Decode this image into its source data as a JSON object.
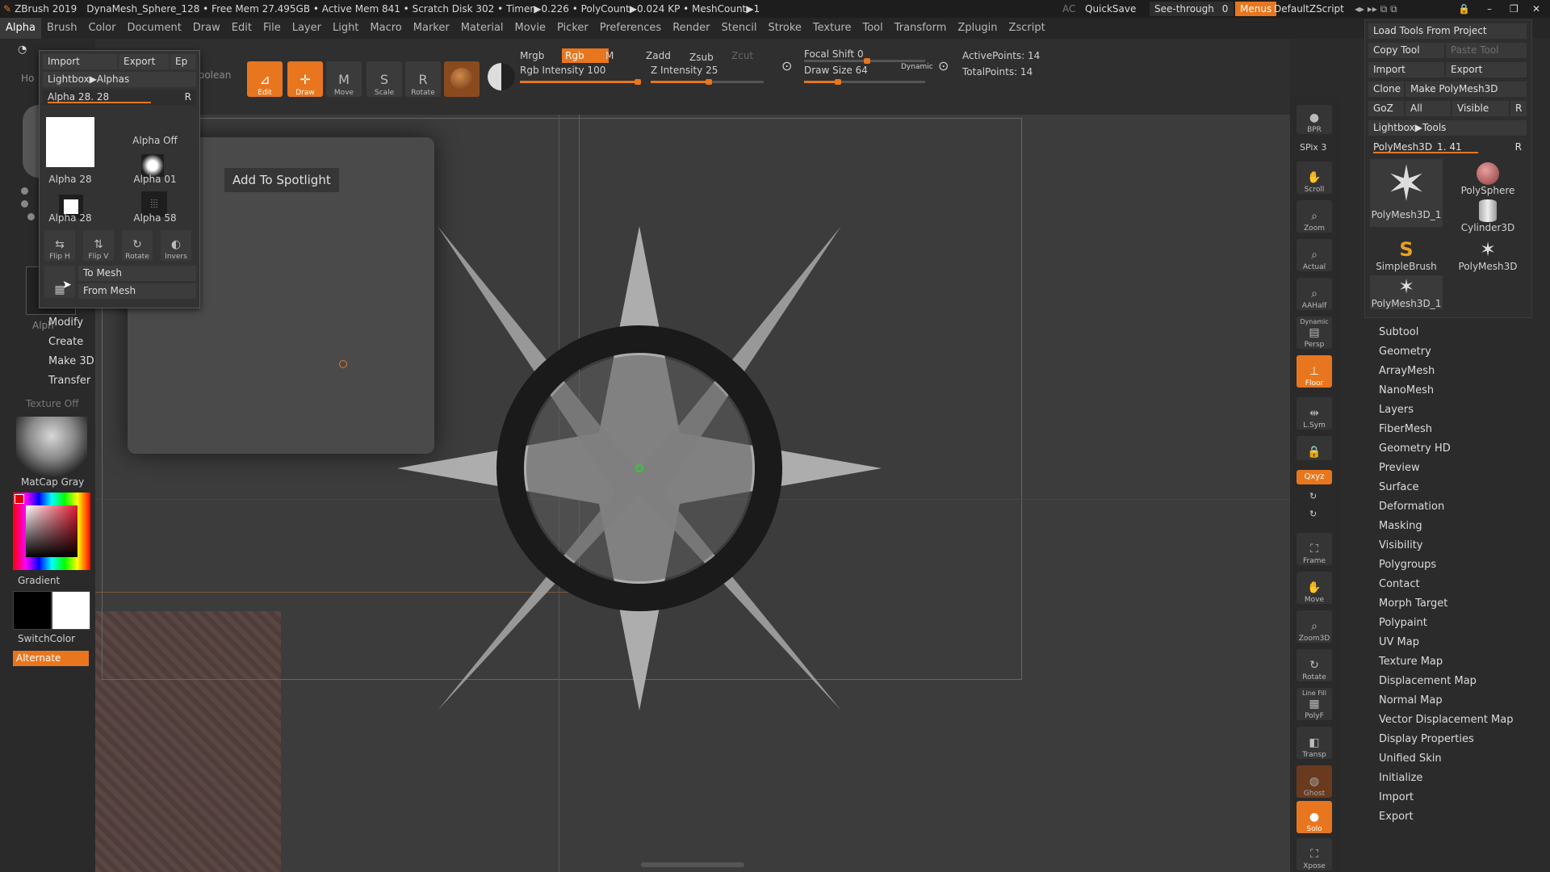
{
  "titlebar": {
    "app": "ZBrush 2019",
    "info": "DynaMesh_Sphere_128   • Free Mem 27.495GB • Active Mem 841 • Scratch Disk 302 • Timer▶0.226 • PolyCount▶0.024 KP • MeshCount▶1",
    "ac": "AC",
    "quicksave": "QuickSave",
    "seethrough": "See-through",
    "seethrough_value": "0",
    "menus": "Menus",
    "script": "DefaultZScript"
  },
  "menubar": {
    "items": [
      "Alpha",
      "Brush",
      "Color",
      "Document",
      "Draw",
      "Edit",
      "File",
      "Layer",
      "Light",
      "Macro",
      "Marker",
      "Material",
      "Movie",
      "Picker",
      "Preferences",
      "Render",
      "Stencil",
      "Stroke",
      "Texture",
      "Tool",
      "Transform",
      "Zplugin",
      "Zscript"
    ]
  },
  "shelf": {
    "edit": "Edit",
    "draw": "Draw",
    "move": "Move",
    "scale": "Scale",
    "rotate": "Rotate",
    "mrgb": "Mrgb",
    "rgb": "Rgb",
    "m": "M",
    "rgb_intensity": "Rgb Intensity 100",
    "rgb_intensity_value": 100,
    "zadd": "Zadd",
    "zsub": "Zsub",
    "zcut": "Zcut",
    "z_intensity": "Z Intensity 25",
    "z_intensity_value": 25,
    "focal_shift": "Focal Shift 0",
    "focal_shift_value": 0,
    "draw_size": "Draw Size 64",
    "draw_size_value": 64,
    "dynamic": "Dynamic",
    "active_points": "ActivePoints: 14",
    "total_points": "TotalPoints: 14"
  },
  "alpha_popup": {
    "import": "Import",
    "export": "Export",
    "ep": "Ep",
    "lightbox": "Lightbox▶Alphas",
    "alpha_slider": "Alpha 28. 28",
    "r": "R",
    "main_thumb_label": "Alpha 28",
    "alpha_off": "Alpha Off",
    "alpha01": "Alpha 01",
    "alpha28": "Alpha 28",
    "alpha58": "Alpha 58",
    "fliph": "Flip H",
    "flipv": "Flip V",
    "rotate": "Rotate",
    "invers": "Invers",
    "to_mesh": "To Mesh",
    "from_mesh": "From Mesh"
  },
  "left": {
    "modify": "Modify",
    "create": "Create",
    "make3d": "Make 3D",
    "transfer": "Transfer",
    "texture_off": "Texture Off",
    "matcap": "MatCap Gray",
    "gradient": "Gradient",
    "switchcolor": "SwitchColor",
    "alternate": "Alternate",
    "partial_ho": "Ho",
    "partial_boolean": "oolean",
    "partial_alpha": "Alph"
  },
  "tooltip": "Add To Spotlight",
  "rightshelf": {
    "bpr": "BPR",
    "spix": "SPix 3",
    "scroll": "Scroll",
    "zoom": "Zoom",
    "actual": "Actual",
    "aahalf": "AAHalf",
    "dynamic": "Dynamic",
    "persp": "Persp",
    "floor": "Floor",
    "lsym": "L.Sym",
    "xyz": "Qxyz",
    "frame": "Frame",
    "move": "Move",
    "zoom3d": "Zoom3D",
    "rotate": "Rotate",
    "linefill": "Line Fill",
    "polyf": "PolyF",
    "transp": "Transp",
    "ghost": "Ghost",
    "solo": "Solo",
    "xpose": "Xpose"
  },
  "toolpanel": {
    "load_tools": "Load Tools From Project",
    "copy_tool": "Copy Tool",
    "paste_tool": "Paste Tool",
    "import": "Import",
    "export": "Export",
    "clone": "Clone",
    "make_polymesh": "Make PolyMesh3D",
    "goz": "GoZ",
    "all": "All",
    "visible": "Visible",
    "r": "R",
    "lightbox": "Lightbox▶Tools",
    "current_tool": "PolyMesh3D_1. 41",
    "tools": [
      "PolyMesh3D_1",
      "PolySphere",
      "Cylinder3D",
      "SimpleBrush",
      "PolyMesh3D",
      "PolyMesh3D_1"
    ]
  },
  "subpalettes": [
    "Subtool",
    "Geometry",
    "ArrayMesh",
    "NanoMesh",
    "Layers",
    "FiberMesh",
    "Geometry HD",
    "Preview",
    "Surface",
    "Deformation",
    "Masking",
    "Visibility",
    "Polygroups",
    "Contact",
    "Morph Target",
    "Polypaint",
    "UV Map",
    "Texture Map",
    "Displacement Map",
    "Normal Map",
    "Vector Displacement Map",
    "Display Properties",
    "Unified Skin",
    "Initialize",
    "Import",
    "Export"
  ],
  "colors": {
    "accent": "#e8761e"
  }
}
